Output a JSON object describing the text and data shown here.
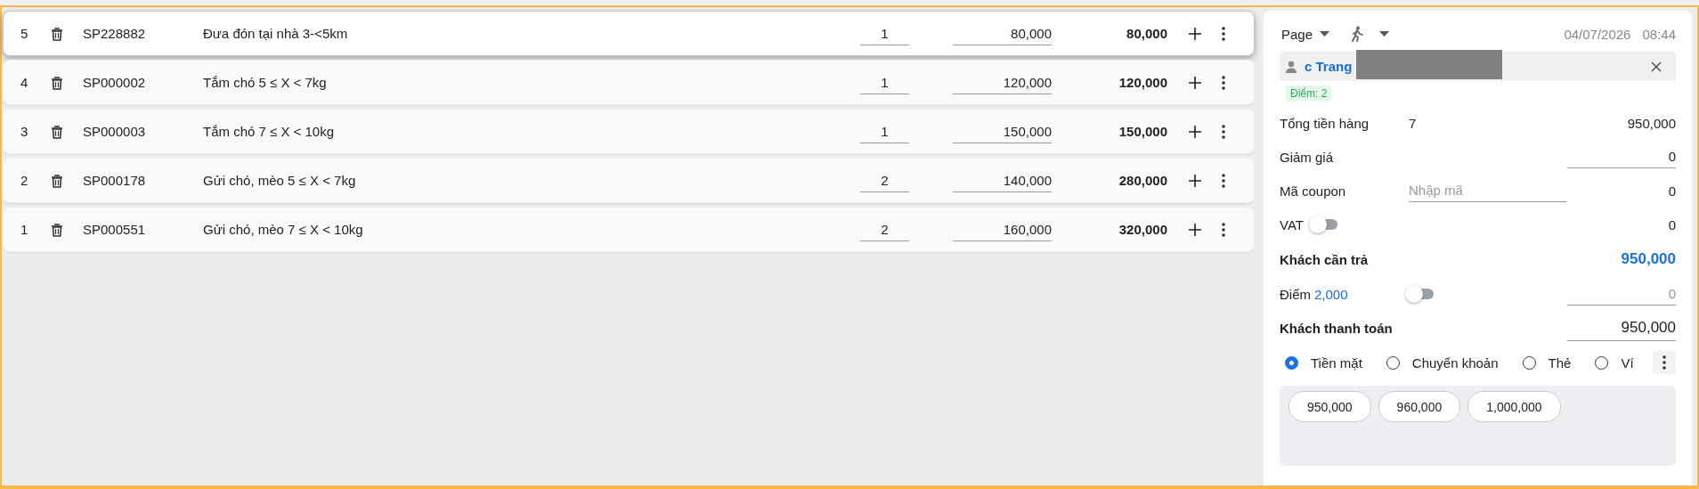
{
  "lines": [
    {
      "index": "5",
      "code": "SP228882",
      "name": "Đưa đón tại nhà 3-<5km",
      "quantity": "1",
      "price": "80,000",
      "total": "80,000",
      "selected": true
    },
    {
      "index": "4",
      "code": "SP000002",
      "name": "Tắm chó 5 ≤ X < 7kg",
      "quantity": "1",
      "price": "120,000",
      "total": "120,000",
      "selected": false
    },
    {
      "index": "3",
      "code": "SP000003",
      "name": "Tắm chó 7 ≤ X < 10kg",
      "quantity": "1",
      "price": "150,000",
      "total": "150,000",
      "selected": false
    },
    {
      "index": "2",
      "code": "SP000178",
      "name": "Gửi chó, mèo 5 ≤ X < 7kg",
      "quantity": "2",
      "price": "140,000",
      "total": "280,000",
      "selected": false
    },
    {
      "index": "1",
      "code": "SP000551",
      "name": "Gửi chó, mèo 7 ≤ X < 10kg",
      "quantity": "2",
      "price": "160,000",
      "total": "320,000",
      "selected": false
    }
  ],
  "sidebar": {
    "header": {
      "page_label": "Page",
      "date": "04/07/2026",
      "time": "08:44"
    },
    "customer": {
      "name": "c Trang",
      "points_badge": "Điểm: 2"
    },
    "summary": [
      {
        "kind": "total",
        "label": "Tổng tiền hàng",
        "count": "7",
        "value": "950,000"
      },
      {
        "kind": "input",
        "label": "Giảm giá",
        "value": "0"
      },
      {
        "kind": "coupon",
        "label": "Mã coupon",
        "placeholder": "Nhập mã",
        "value": "0"
      },
      {
        "kind": "toggle",
        "label": "VAT",
        "on": false,
        "value": "0"
      },
      {
        "kind": "due",
        "label": "Khách cần trả",
        "value": "950,000"
      },
      {
        "kind": "points",
        "label": "Điểm",
        "points": "2,000",
        "on": false,
        "placeholder": "0"
      },
      {
        "kind": "paid",
        "label": "Khách thanh toán",
        "value": "950,000"
      }
    ],
    "payment_methods": [
      {
        "label": "Tiền mặt",
        "selected": true
      },
      {
        "label": "Chuyển khoản",
        "selected": false
      },
      {
        "label": "Thẻ",
        "selected": false
      },
      {
        "label": "Ví",
        "selected": false
      }
    ],
    "quick_amounts": [
      "950,000",
      "960,000",
      "1,000,000"
    ]
  }
}
